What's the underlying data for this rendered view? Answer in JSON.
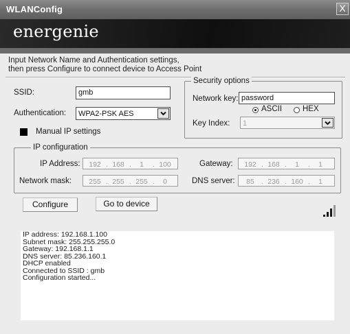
{
  "window": {
    "title": "WLANConfig",
    "close_glyph": "X"
  },
  "brand": {
    "logo_text": "energenie"
  },
  "instructions": [
    "Input Network Name and Authentication settings,",
    "then press Configure to connect device to Access Point"
  ],
  "form": {
    "ssid_label": "SSID:",
    "ssid_value": "gmb",
    "auth_label": "Authentication:",
    "auth_value": "WPA2-PSK AES",
    "manual_ip_label": "Manual IP settings"
  },
  "security": {
    "legend": "Security options",
    "key_label": "Network key:",
    "key_value": "password",
    "ascii_label": "ASCII",
    "hex_label": "HEX",
    "selected_format": "ASCII",
    "key_index_label": "Key Index:",
    "key_index_value": "1"
  },
  "ipconfig": {
    "legend": "IP configuration",
    "ip_label": "IP Address:",
    "ip": [
      "192",
      "168",
      "1",
      "100"
    ],
    "mask_label": "Network mask:",
    "mask": [
      "255",
      "255",
      "255",
      "0"
    ],
    "gateway_label": "Gateway:",
    "gateway": [
      "192",
      "168",
      "1",
      "1"
    ],
    "dns_label": "DNS server:",
    "dns": [
      "85",
      "236",
      "160",
      "1"
    ]
  },
  "buttons": {
    "configure": "Configure",
    "goto_device": "Go to device"
  },
  "icons": {
    "signal": "signal-strength-icon",
    "close": "close-icon",
    "dropdown": "chevron-down-icon"
  },
  "log": [
    "IP address:  192.168.1.100",
    "Subnet mask:  255.255.255.0",
    "Gateway:  192.168.1.1",
    "DNS server:  85.236.160.1",
    "DHCP enabled",
    "Connected to SSID : gmb",
    "Configuration started..."
  ],
  "colors": {
    "title_bar": "#6e6e6e",
    "brand_bar": "#111111",
    "window_bg": "#ececec"
  }
}
